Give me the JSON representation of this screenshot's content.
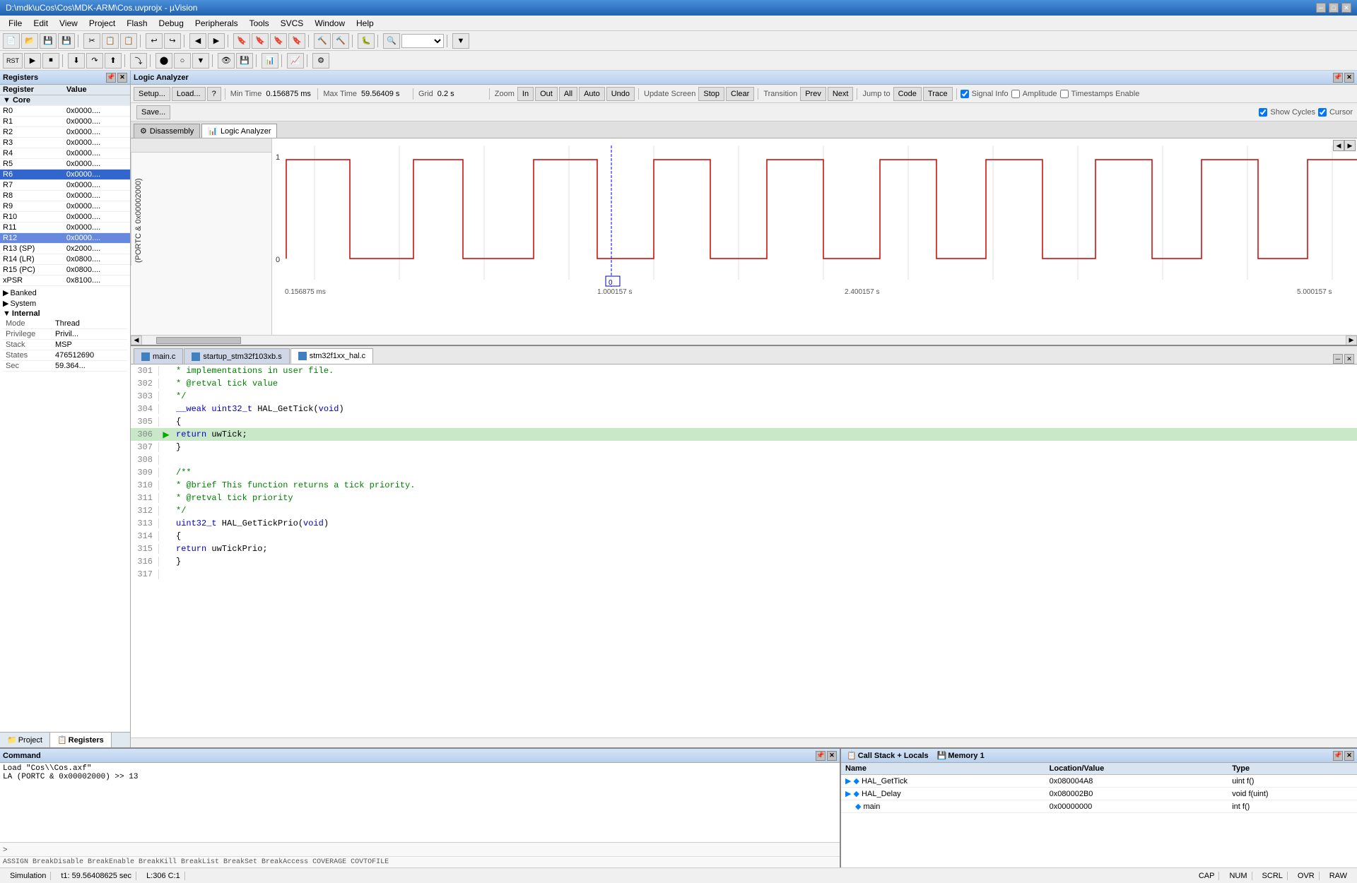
{
  "window": {
    "title": "D:\\mdk\\uCos\\Cos\\MDK-ARM\\Cos.uvprojx - µVision",
    "min_btn": "─",
    "max_btn": "□",
    "close_btn": "✕"
  },
  "menu": {
    "items": [
      "File",
      "Edit",
      "View",
      "Project",
      "Flash",
      "Debug",
      "Peripherals",
      "Tools",
      "SVCS",
      "Window",
      "Help"
    ]
  },
  "registers": {
    "panel_title": "Registers",
    "columns": [
      "Register",
      "Value"
    ],
    "core_label": "Core",
    "regs": [
      {
        "name": "R0",
        "value": "0x0000...."
      },
      {
        "name": "R1",
        "value": "0x0000...."
      },
      {
        "name": "R2",
        "value": "0x0000...."
      },
      {
        "name": "R3",
        "value": "0x0000...."
      },
      {
        "name": "R4",
        "value": "0x0000...."
      },
      {
        "name": "R5",
        "value": "0x0000...."
      },
      {
        "name": "R6",
        "value": "0x0000...."
      },
      {
        "name": "R7",
        "value": "0x0000...."
      },
      {
        "name": "R8",
        "value": "0x0000...."
      },
      {
        "name": "R9",
        "value": "0x0000...."
      },
      {
        "name": "R10",
        "value": "0x0000...."
      },
      {
        "name": "R11",
        "value": "0x0000...."
      },
      {
        "name": "R12",
        "value": "0x0000...."
      },
      {
        "name": "R13 (SP)",
        "value": "0x2000...."
      },
      {
        "name": "R14 (LR)",
        "value": "0x0800...."
      },
      {
        "name": "R15 (PC)",
        "value": "0x0800...."
      },
      {
        "name": "xPSR",
        "value": "0x8100...."
      }
    ],
    "sections": [
      {
        "name": "Banked"
      },
      {
        "name": "System"
      },
      {
        "name": "Internal"
      }
    ],
    "mode_label": "Mode",
    "mode_value": "Thread",
    "privilege_label": "Privilege",
    "privilege_value": "Privil...",
    "stack_label": "Stack",
    "stack_value": "MSP",
    "states_label": "States",
    "states_value": "476512690",
    "sec_label": "Sec",
    "sec_value": "59.364..."
  },
  "bottom_tabs": [
    {
      "label": "Project",
      "icon": "📁"
    },
    {
      "label": "Registers",
      "icon": "📋",
      "active": true
    }
  ],
  "logic_analyzer": {
    "panel_title": "Logic Analyzer",
    "setup_btn": "Setup...",
    "load_btn": "Load...",
    "save_btn": "Save...",
    "help_btn": "?",
    "min_time_label": "Min Time",
    "min_time_value": "0.156875 ms",
    "max_time_label": "Max Time",
    "max_time_value": "59.56409 s",
    "grid_label": "Grid",
    "grid_value": "0.2 s",
    "zoom_label": "Zoom",
    "zoom_in_btn": "In",
    "zoom_out_btn": "Out",
    "zoom_all_btn": "All",
    "zoom_auto_btn": "Auto",
    "zoom_undo_btn": "Undo",
    "update_screen_label": "Update Screen",
    "stop_btn": "Stop",
    "clear_btn": "Clear",
    "transition_label": "Transition",
    "prev_btn": "Prev",
    "next_btn": "Next",
    "jump_to_label": "Jump to",
    "code_btn": "Code",
    "trace_btn": "Trace",
    "signal_info_label": "Signal Info",
    "amplitude_label": "Amplitude",
    "timestamps_label": "Timestamps Enable",
    "show_cycles_label": "Show Cycles",
    "cursor_label": "Cursor",
    "signal_name": "(PORTC & 0x00002000)",
    "signal_label_y_top": "1",
    "signal_label_y_bot": "0",
    "time_markers": [
      "0.156875 ms",
      "1.000157 s",
      "2.400157 s",
      "5.000157 s"
    ],
    "cursor_time": "0",
    "view_tabs": [
      {
        "label": "Disassembly",
        "icon": "⚙"
      },
      {
        "label": "Logic Analyzer",
        "icon": "📊",
        "active": true
      }
    ]
  },
  "code_editor": {
    "tabs": [
      {
        "label": "main.c",
        "active": false
      },
      {
        "label": "startup_stm32f103xb.s",
        "active": false
      },
      {
        "label": "stm32f1xx_hal.c",
        "active": true
      }
    ],
    "lines": [
      {
        "num": 301,
        "code": "   *  implementations in user file.",
        "class": "code-comment",
        "arrow": false,
        "highlight": false
      },
      {
        "num": 302,
        "code": "   * @retval tick value",
        "class": "code-comment",
        "arrow": false,
        "highlight": false
      },
      {
        "num": 303,
        "code": "   */",
        "class": "code-comment",
        "arrow": false,
        "highlight": false
      },
      {
        "num": 304,
        "code": "__weak uint32_t HAL_GetTick(void)",
        "class": "",
        "arrow": false,
        "highlight": false
      },
      {
        "num": 305,
        "code": "{",
        "class": "",
        "arrow": false,
        "highlight": false
      },
      {
        "num": 306,
        "code": "  return uwTick;",
        "class": "",
        "arrow": true,
        "highlight": true
      },
      {
        "num": 307,
        "code": "}",
        "class": "",
        "arrow": false,
        "highlight": false
      },
      {
        "num": 308,
        "code": "",
        "class": "",
        "arrow": false,
        "highlight": false
      },
      {
        "num": 309,
        "code": "/**",
        "class": "code-comment",
        "arrow": false,
        "highlight": false
      },
      {
        "num": 310,
        "code": "  * @brief This function returns a tick priority.",
        "class": "code-comment",
        "arrow": false,
        "highlight": false
      },
      {
        "num": 311,
        "code": "  * @retval tick priority",
        "class": "code-comment",
        "arrow": false,
        "highlight": false
      },
      {
        "num": 312,
        "code": "  */",
        "class": "code-comment",
        "arrow": false,
        "highlight": false
      },
      {
        "num": 313,
        "code": "uint32_t HAL_GetTickPrio(void)",
        "class": "",
        "arrow": false,
        "highlight": false
      },
      {
        "num": 314,
        "code": "{",
        "class": "",
        "arrow": false,
        "highlight": false
      },
      {
        "num": 315,
        "code": "  return uwTickPrio;",
        "class": "",
        "arrow": false,
        "highlight": false
      },
      {
        "num": 316,
        "code": "}",
        "class": "",
        "arrow": false,
        "highlight": false
      },
      {
        "num": 317,
        "code": "",
        "class": "",
        "arrow": false,
        "highlight": false
      }
    ]
  },
  "command": {
    "panel_title": "Command",
    "output_lines": [
      "Load \"Cos\\\\Cos.axf\"",
      "LA (PORTC & 0x00002000) >> 13"
    ],
    "autocomplete": "ASSIGN BreakDisable BreakEnable BreakKill BreakList BreakSet BreakAccess COVERAGE COVTOFILE"
  },
  "callstack": {
    "panel_title": "Call Stack + Locals",
    "mem_tab": "Memory 1",
    "columns": [
      "Name",
      "Location/Value",
      "Type"
    ],
    "rows": [
      {
        "name": "HAL_GetTick",
        "location": "0x080004A8",
        "type": "uint f()"
      },
      {
        "name": "HAL_Delay",
        "location": "0x080002B0",
        "type": "void f(uint)"
      },
      {
        "name": "main",
        "location": "0x00000000",
        "type": "int f()"
      }
    ]
  },
  "status_bar": {
    "simulation_label": "Simulation",
    "time_label": "t1: 59.56408625 sec",
    "line_label": "L:306 C:1",
    "caps": "CAP",
    "num": "NUM",
    "scrl": "SCRL",
    "ovr": "OVR",
    "raw": "RAW"
  }
}
